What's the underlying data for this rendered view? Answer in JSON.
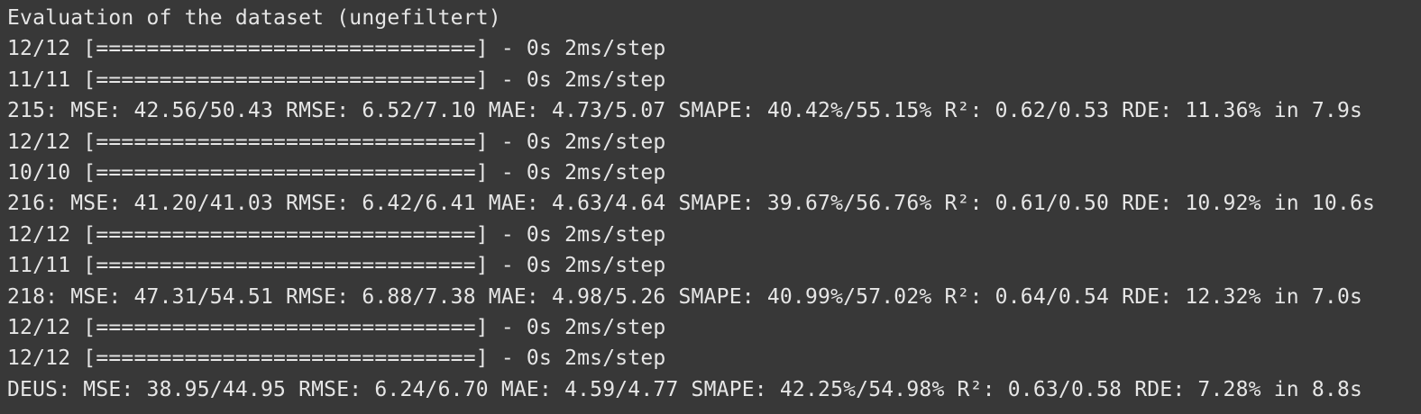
{
  "terminal": {
    "lines": [
      "Evaluation of the dataset (ungefiltert)",
      "12/12 [==============================] - 0s 2ms/step",
      "11/11 [==============================] - 0s 2ms/step",
      "215: MSE: 42.56/50.43 RMSE: 6.52/7.10 MAE: 4.73/5.07 SMAPE: 40.42%/55.15% R²: 0.62/0.53 RDE: 11.36% in 7.9s",
      "12/12 [==============================] - 0s 2ms/step",
      "10/10 [==============================] - 0s 2ms/step",
      "216: MSE: 41.20/41.03 RMSE: 6.42/6.41 MAE: 4.63/4.64 SMAPE: 39.67%/56.76% R²: 0.61/0.50 RDE: 10.92% in 10.6s",
      "12/12 [==============================] - 0s 2ms/step",
      "11/11 [==============================] - 0s 2ms/step",
      "218: MSE: 47.31/54.51 RMSE: 6.88/7.38 MAE: 4.98/5.26 SMAPE: 40.99%/57.02% R²: 0.64/0.54 RDE: 12.32% in 7.0s",
      "12/12 [==============================] - 0s 2ms/step",
      "12/12 [==============================] - 0s 2ms/step",
      "DEUS: MSE: 38.95/44.95 RMSE: 6.24/6.70 MAE: 4.59/4.77 SMAPE: 42.25%/54.98% R²: 0.63/0.58 RDE: 7.28% in 8.8s"
    ]
  }
}
